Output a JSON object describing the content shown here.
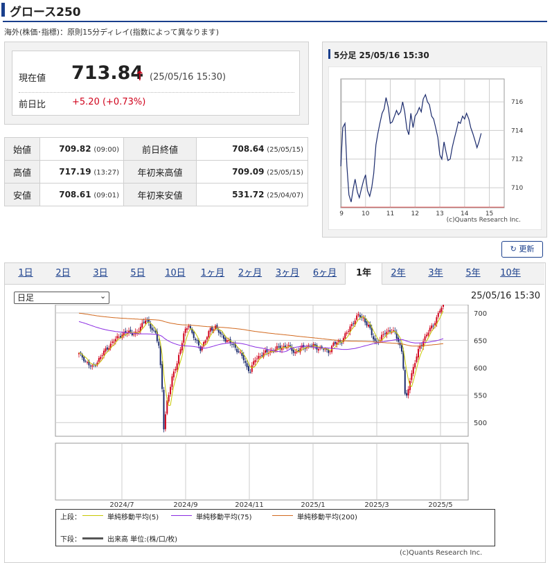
{
  "header": {
    "title": "グロース250",
    "delay_note": "海外(株価･指標)：原則15分ディレイ(指数によって異なります)"
  },
  "price": {
    "current_label": "現在値",
    "current_value": "713.84",
    "current_time": "(25/05/16 15:30)",
    "change_label": "前日比",
    "change_value": "+5.20 (+0.73%)",
    "up_arrow": "↑"
  },
  "stats": {
    "open_label": "始値",
    "open_value": "709.82",
    "open_time": "(09:00)",
    "high_label": "高値",
    "high_value": "717.19",
    "high_time": "(13:27)",
    "low_label": "安値",
    "low_value": "708.61",
    "low_time": "(09:01)",
    "prev_close_label": "前日終値",
    "prev_close_value": "708.64",
    "prev_close_date": "(25/05/15)",
    "ytd_high_label": "年初来高値",
    "ytd_high_value": "709.09",
    "ytd_high_date": "(25/05/15)",
    "ytd_low_label": "年初来安値",
    "ytd_low_value": "531.72",
    "ytd_low_date": "(25/04/07)"
  },
  "intraday": {
    "title": "5分足 25/05/16 15:30",
    "credit": "(c)Quants Research Inc."
  },
  "update_button": "更新",
  "tabs": [
    "1日",
    "2日",
    "3日",
    "5日",
    "10日",
    "1ヶ月",
    "2ヶ月",
    "3ヶ月",
    "6ヶ月",
    "1年",
    "2年",
    "3年",
    "5年",
    "10年"
  ],
  "active_tab": "1年",
  "period_select": "日足",
  "main_time": "25/05/16 15:30",
  "legend": {
    "upper_label": "上段：",
    "ma5": "単純移動平均(5)",
    "ma75": "単純移動平均(75)",
    "ma200": "単純移動平均(200)",
    "lower_label": "下段：",
    "volume": "出来高 単位:(株/口/枚)"
  },
  "credit_main": "(c)Quants Research Inc.",
  "colors": {
    "up": "#d0021b",
    "down": "#1a2a6c",
    "line": "#1a2a6c",
    "ma5": "#c8c800",
    "ma75": "#8a2be2",
    "ma200": "#d2691e",
    "baseline": "#e05050"
  },
  "chart_data": [
    {
      "type": "line",
      "title": "5分足 25/05/16 15:30",
      "x_ticks": [
        "9",
        "10",
        "11",
        "12",
        "13",
        "14",
        "15"
      ],
      "y_ticks": [
        710,
        712,
        714,
        716
      ],
      "ylim": [
        708.6,
        717.6
      ],
      "xlim": [
        9.0,
        15.6
      ],
      "reference_line": 708.64,
      "x": [
        9.0,
        9.08,
        9.17,
        9.25,
        9.33,
        9.42,
        9.5,
        9.58,
        9.67,
        9.75,
        9.83,
        9.92,
        10.0,
        10.08,
        10.17,
        10.25,
        10.33,
        10.42,
        10.5,
        10.58,
        10.67,
        10.75,
        10.83,
        10.92,
        11.0,
        11.08,
        11.17,
        11.25,
        11.33,
        11.42,
        11.5,
        11.58,
        11.67,
        11.75,
        11.83,
        11.92,
        12.0,
        12.08,
        12.17,
        12.25,
        12.33,
        12.42,
        12.5,
        12.58,
        12.67,
        12.75,
        12.83,
        12.92,
        13.0,
        13.08,
        13.17,
        13.25,
        13.33,
        13.42,
        13.5,
        13.58,
        13.67,
        13.75,
        13.83,
        13.92,
        14.0,
        14.08,
        14.17,
        14.25,
        14.33,
        14.42,
        14.5,
        14.58,
        14.67,
        14.75,
        14.83,
        14.92,
        15.0,
        15.08,
        15.17,
        15.25,
        15.33,
        15.42,
        15.5
      ],
      "y": [
        711.5,
        714.2,
        714.5,
        711.5,
        709.5,
        709.0,
        709.9,
        710.6,
        709.7,
        709.3,
        709.9,
        710.5,
        710.9,
        709.8,
        709.4,
        710.0,
        711.0,
        713.0,
        713.8,
        714.5,
        715.2,
        715.5,
        716.3,
        715.6,
        714.5,
        714.6,
        715.0,
        715.4,
        715.1,
        715.3,
        716.0,
        715.3,
        714.1,
        713.7,
        715.2,
        714.2,
        715.0,
        715.2,
        715.6,
        715.3,
        716.2,
        716.5,
        716.0,
        715.8,
        715.0,
        714.8,
        714.2,
        713.5,
        712.3,
        712.0,
        713.2,
        712.5,
        711.9,
        712.0,
        712.8,
        713.4,
        714.0,
        714.6,
        714.5,
        715.0,
        714.8,
        715.2,
        714.8,
        714.2,
        713.8,
        713.3,
        712.8,
        713.2,
        713.8
      ],
      "credit": "(c)Quants Research Inc."
    },
    {
      "type": "candlestick",
      "period": "日足",
      "x_ticks": [
        "2024/7",
        "2024/9",
        "2024/11",
        "2025/1",
        "2025/3",
        "2025/5"
      ],
      "y_ticks": [
        500,
        550,
        600,
        650,
        700
      ],
      "ylim": [
        475,
        715
      ],
      "series": [
        {
          "name": "単純移動平均(5)",
          "color": "#c8c800"
        },
        {
          "name": "単純移動平均(75)",
          "color": "#8a2be2"
        },
        {
          "name": "単純移動平均(200)",
          "color": "#d2691e"
        }
      ],
      "close_anchors": [
        [
          0,
          625
        ],
        [
          8,
          600
        ],
        [
          18,
          640
        ],
        [
          25,
          660
        ],
        [
          30,
          665
        ],
        [
          35,
          662
        ],
        [
          38,
          680
        ],
        [
          40,
          690
        ],
        [
          43,
          672
        ],
        [
          46,
          665
        ],
        [
          48,
          640
        ],
        [
          50,
          560
        ],
        [
          51,
          490
        ],
        [
          53,
          540
        ],
        [
          56,
          580
        ],
        [
          59,
          610
        ],
        [
          63,
          660
        ],
        [
          66,
          680
        ],
        [
          68,
          663
        ],
        [
          70,
          650
        ],
        [
          73,
          635
        ],
        [
          76,
          650
        ],
        [
          79,
          670
        ],
        [
          82,
          675
        ],
        [
          85,
          660
        ],
        [
          89,
          650
        ],
        [
          93,
          640
        ],
        [
          96,
          630
        ],
        [
          99,
          615
        ],
        [
          101,
          600
        ],
        [
          103,
          595
        ],
        [
          106,
          615
        ],
        [
          110,
          625
        ],
        [
          115,
          630
        ],
        [
          120,
          636
        ],
        [
          125,
          640
        ],
        [
          130,
          628
        ],
        [
          135,
          638
        ],
        [
          140,
          640
        ],
        [
          145,
          636
        ],
        [
          150,
          630
        ],
        [
          153,
          643
        ],
        [
          158,
          650
        ],
        [
          162,
          668
        ],
        [
          165,
          685
        ],
        [
          168,
          695
        ],
        [
          171,
          690
        ],
        [
          174,
          676
        ],
        [
          176,
          660
        ],
        [
          178,
          648
        ],
        [
          181,
          650
        ],
        [
          184,
          665
        ],
        [
          187,
          668
        ],
        [
          190,
          662
        ],
        [
          192,
          650
        ],
        [
          194,
          630
        ],
        [
          195,
          600
        ],
        [
          196,
          550
        ],
        [
          197,
          545
        ],
        [
          199,
          580
        ],
        [
          202,
          610
        ],
        [
          205,
          640
        ],
        [
          208,
          655
        ],
        [
          211,
          670
        ],
        [
          213,
          680
        ],
        [
          215,
          690
        ],
        [
          217,
          705
        ],
        [
          219,
          712
        ]
      ],
      "volume": "出来高"
    }
  ]
}
